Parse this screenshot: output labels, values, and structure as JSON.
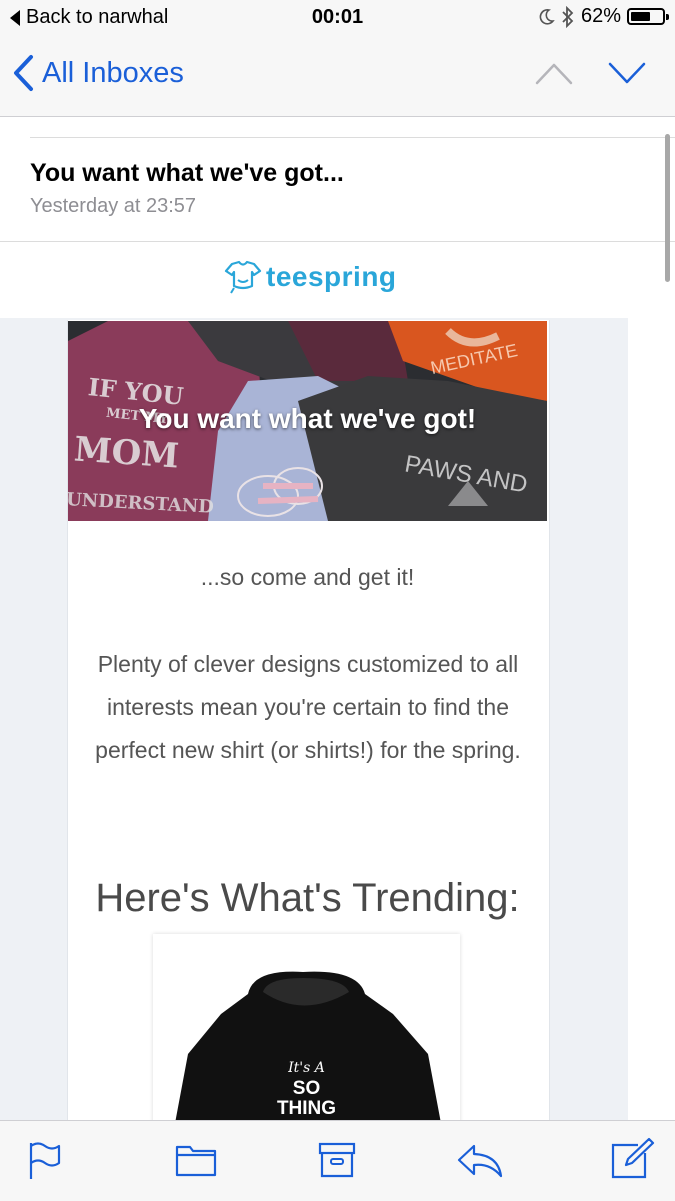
{
  "status_bar": {
    "back_app": "Back to narwhal",
    "time": "00:01",
    "battery": "62%",
    "battery_level": 0.62
  },
  "nav": {
    "back_label": "All Inboxes",
    "prev_icon": "chevron-up-icon",
    "next_icon": "chevron-down-icon"
  },
  "message": {
    "subject": "You want what we've got...",
    "date": "Yesterday at 23:57"
  },
  "email": {
    "brand": "teespring",
    "hero_title": "You want what we've got!",
    "hero_shirt_texts": [
      "IF YOU",
      "MET MY",
      "MOM",
      "UNDERSTAND",
      "PAWS AND",
      "MEDITATE"
    ],
    "subheading": "...so come and get it!",
    "paragraph": "Plenty of clever designs customized to all interests mean you're certain to find the perfect new shirt (or shirts!) for the spring.",
    "trending_heading": "Here's What's Trending:",
    "product_text": [
      "It's A",
      "SO",
      "THING"
    ]
  },
  "toolbar": {
    "icons": [
      "flag-icon",
      "folder-icon",
      "archive-icon",
      "reply-icon",
      "compose-icon"
    ]
  },
  "colors": {
    "accent": "#1a5fd8",
    "brand": "#2aa6d9"
  }
}
